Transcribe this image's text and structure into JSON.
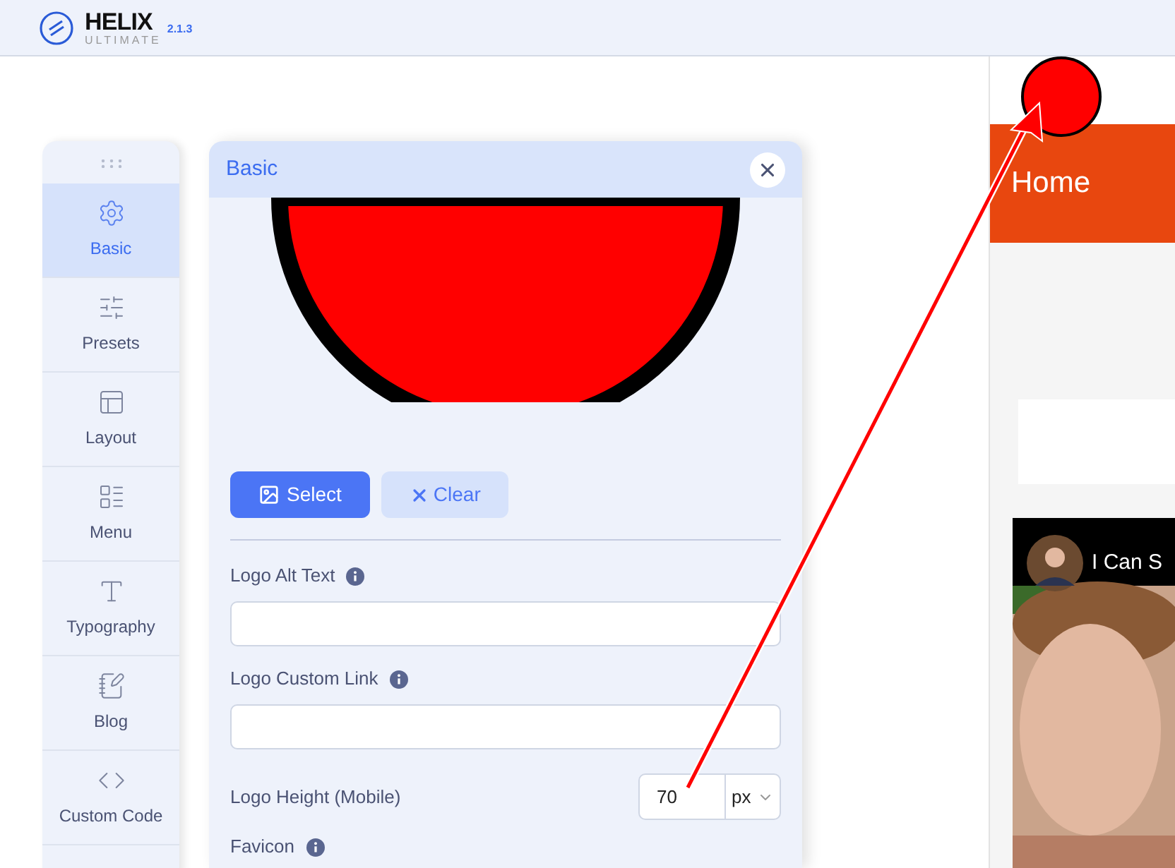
{
  "header": {
    "logo_title": "HELIX",
    "logo_subtitle": "ULTIMATE",
    "version": "2.1.3"
  },
  "sidebar": {
    "items": [
      {
        "label": "Basic",
        "selected": true
      },
      {
        "label": "Presets",
        "selected": false
      },
      {
        "label": "Layout",
        "selected": false
      },
      {
        "label": "Menu",
        "selected": false
      },
      {
        "label": "Typography",
        "selected": false
      },
      {
        "label": "Blog",
        "selected": false
      },
      {
        "label": "Custom Code",
        "selected": false
      }
    ]
  },
  "panel": {
    "title": "Basic",
    "buttons": [
      {
        "label": "Select",
        "kind": "primary"
      },
      {
        "label": "Clear",
        "kind": "secondary"
      }
    ],
    "fields": [
      {
        "label": "Logo Alt Text",
        "kind": "text"
      },
      {
        "label": "Logo Custom Link",
        "kind": "text"
      },
      {
        "label": "Logo Height (Mobile)",
        "kind": "number",
        "value": "70",
        "unit": "px"
      },
      {
        "label": "Favicon",
        "kind": "heading"
      }
    ]
  },
  "preview": {
    "menu_item": "Home",
    "video_title": "I Can S"
  }
}
